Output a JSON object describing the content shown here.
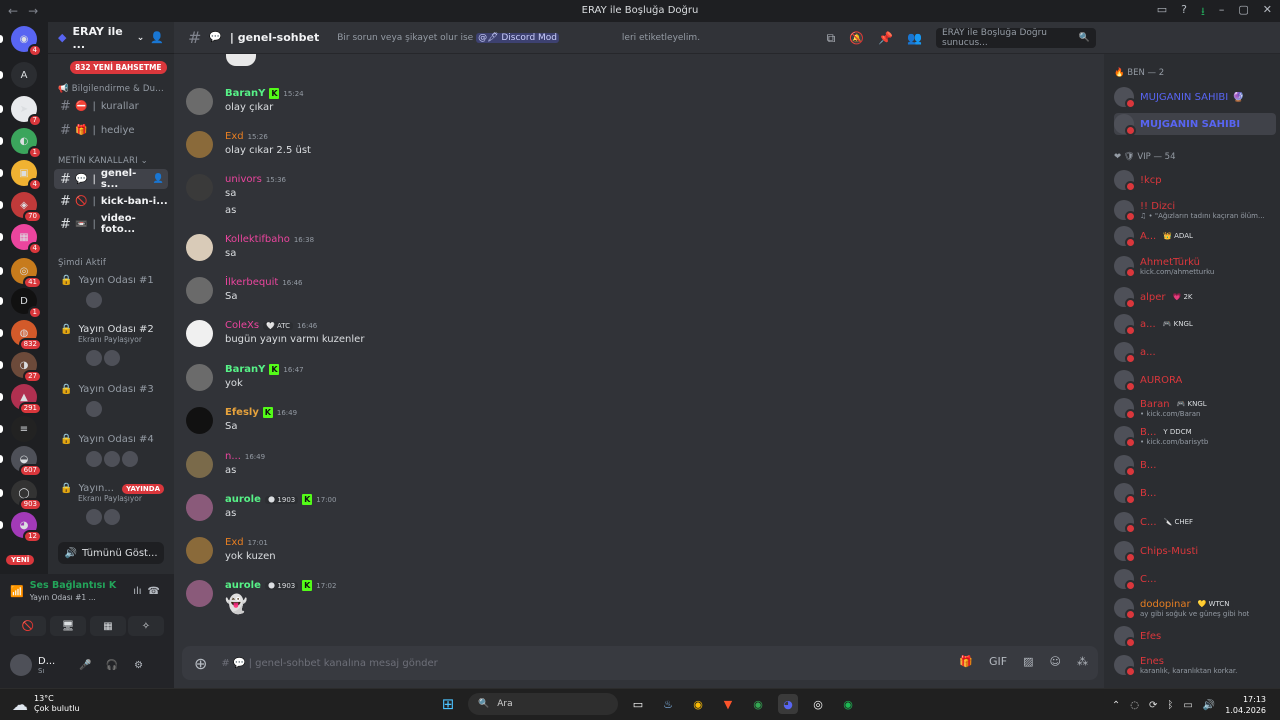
{
  "window": {
    "title": "ERAY ile Boşluğa Doğru"
  },
  "rail": {
    "servers": [
      {
        "glyph": "◉",
        "badge": "4"
      },
      {
        "glyph": "A",
        "badge": ""
      },
      {
        "glyph": "➤",
        "badge": "7"
      },
      {
        "glyph": "◐",
        "badge": "1"
      },
      {
        "glyph": "▣",
        "badge": "4"
      },
      {
        "glyph": "◈",
        "badge": "70"
      },
      {
        "glyph": "▦",
        "badge": "4"
      },
      {
        "glyph": "◎",
        "badge": "41"
      },
      {
        "glyph": "D",
        "badge": "1"
      },
      {
        "glyph": "◍",
        "badge": "832"
      },
      {
        "glyph": "◑",
        "badge": "27"
      },
      {
        "glyph": "▲",
        "badge": "291"
      },
      {
        "glyph": "≡",
        "badge": ""
      },
      {
        "glyph": "◒",
        "badge": "607"
      },
      {
        "glyph": "◯",
        "badge": "903"
      },
      {
        "glyph": "◕",
        "badge": "12"
      }
    ],
    "new_label": "YENİ"
  },
  "sidebar": {
    "guild_name": "ERAY ile ...",
    "mention_pill": "832 YENİ BAHSETME",
    "category_info": "Bilgilendirme & Du...",
    "channels_top": [
      {
        "icon": "⛔",
        "name": "kurallar"
      },
      {
        "icon": "🎁",
        "name": "hediye"
      }
    ],
    "text_category": "METİN KANALLARI",
    "text_channels": [
      {
        "icon": "💬",
        "name": "genel-s...",
        "active": true
      },
      {
        "icon": "🚫",
        "name": "kick-ban-i...",
        "active": false
      },
      {
        "icon": "📼",
        "name": "video-foto...",
        "active": false
      }
    ],
    "active_now": "Şimdi Aktif",
    "voice": [
      {
        "name": "Yayın Odası #1",
        "sub": "",
        "live": ""
      },
      {
        "name": "Yayın Odası #2",
        "sub": "Ekranı Paylaşıyor",
        "live": ""
      },
      {
        "name": "Yayın Odası #3",
        "sub": "",
        "live": ""
      },
      {
        "name": "Yayın Odası #4",
        "sub": "",
        "live": ""
      },
      {
        "name": "Yayın...",
        "sub": "Ekranı Paylaşıyor",
        "live": "YAYINDA"
      }
    ],
    "show_all": "Tümünü Göst..."
  },
  "user_panel": {
    "voice_title": "Ses Bağlantısı K",
    "voice_room": "Yayın Odası #1 ...",
    "username": "D...",
    "status": "Sı"
  },
  "chat": {
    "channel_title": "| genel-sohbet",
    "topic_prefix": "Bir sorun veya şikayet olur ise",
    "topic_mention": "@🖋 Discord Mod",
    "topic_suffix": "leri etiketleyelim.",
    "search_placeholder": "ERAY ile Boşluğa Doğru sunucus...",
    "composer_placeholder": "| genel-sohbet kanalına mesaj gönder",
    "messages": [
      {
        "author": "BaranY",
        "color": "#57f287",
        "kick": true,
        "tag": "",
        "time": "15:24",
        "lines": [
          "olay çıkar"
        ]
      },
      {
        "author": "Exd",
        "color": "#e67e22",
        "kick": false,
        "tag": "",
        "time": "15:26",
        "lines": [
          "olay cıkar 2.5 üst"
        ]
      },
      {
        "author": "univors",
        "color": "#eb459e",
        "kick": false,
        "tag": "",
        "time": "15:36",
        "lines": [
          "sa",
          "as"
        ]
      },
      {
        "author": "Kollektifbaho",
        "color": "#eb459e",
        "kick": false,
        "tag": "",
        "time": "16:38",
        "lines": [
          "sa"
        ]
      },
      {
        "author": "İlkerbequit",
        "color": "#eb459e",
        "kick": false,
        "tag": "",
        "time": "16:46",
        "lines": [
          "Sa"
        ]
      },
      {
        "author": "ColeXs",
        "color": "#eb459e",
        "kick": false,
        "tag": "🤍 ATC",
        "time": "16:46",
        "lines": [
          "bugün yayın varmı kuzenler"
        ]
      },
      {
        "author": "BaranY",
        "color": "#57f287",
        "kick": true,
        "tag": "",
        "time": "16:47",
        "lines": [
          "yok"
        ]
      },
      {
        "author": "Efesly",
        "color": "#e6a23c",
        "kick": true,
        "tag": "",
        "time": "16:49",
        "lines": [
          "Sa"
        ]
      },
      {
        "author": "n...",
        "color": "#eb459e",
        "kick": false,
        "tag": "",
        "time": "16:49",
        "lines": [
          "as"
        ]
      },
      {
        "author": "aurole",
        "color": "#57f287",
        "kick": true,
        "tag": "🌑 1903",
        "time": "17:00",
        "lines": [
          "as"
        ]
      },
      {
        "author": "Exd",
        "color": "#e67e22",
        "kick": false,
        "tag": "",
        "time": "17:01",
        "lines": [
          "yok kuzen"
        ]
      },
      {
        "author": "aurole",
        "color": "#57f287",
        "kick": true,
        "tag": "🌑 1903",
        "time": "17:02",
        "lines": [
          "👻"
        ]
      }
    ]
  },
  "members": {
    "group1": "BEN — 2",
    "group1_members": [
      {
        "name": "MÜJGANIN SAHİBİ",
        "extra": "🔮",
        "color": "#5865f2",
        "status": ""
      },
      {
        "name": "MUJGANIN SAHİBİ",
        "extra": "",
        "color": "#5865f2",
        "status": ""
      }
    ],
    "group2": "VIP — 54",
    "group2_members": [
      {
        "name": "!kcp",
        "extra": "",
        "color": "#da373c",
        "status": ""
      },
      {
        "name": "!! Dizci",
        "extra": "",
        "color": "#da373c",
        "status": "♫ • \"Ağızların tadını kaçıran ölüm..."
      },
      {
        "name": "A...",
        "extra": "👑 ADAL",
        "color": "#da373c",
        "status": ""
      },
      {
        "name": "AhmetTürkü",
        "extra": "",
        "color": "#da373c",
        "status": "kick.com/ahmetturku"
      },
      {
        "name": "alper",
        "extra": "💗 2K",
        "color": "#da373c",
        "status": ""
      },
      {
        "name": "a...",
        "extra": "🎮 KNGL",
        "color": "#da373c",
        "status": ""
      },
      {
        "name": "a...",
        "extra": "",
        "color": "#da373c",
        "status": ""
      },
      {
        "name": "AURORA",
        "extra": "",
        "color": "#da373c",
        "status": ""
      },
      {
        "name": "Baran",
        "extra": "🎮 KNGL",
        "color": "#da373c",
        "status": "• kick.com/Baran"
      },
      {
        "name": "B...",
        "extra": "Y DDCM",
        "color": "#da373c",
        "status": "• kick.com/barisytb"
      },
      {
        "name": "B...",
        "extra": "",
        "color": "#da373c",
        "status": ""
      },
      {
        "name": "B...",
        "extra": "",
        "color": "#da373c",
        "status": ""
      },
      {
        "name": "C...",
        "extra": "🔪 CHEF",
        "color": "#da373c",
        "status": ""
      },
      {
        "name": "Chips-Musti",
        "extra": "",
        "color": "#da373c",
        "status": ""
      },
      {
        "name": "C...",
        "extra": "",
        "color": "#da373c",
        "status": ""
      },
      {
        "name": "dodopinar",
        "extra": "💛 WTCN",
        "color": "#e67e22",
        "status": "ay gibi soğuk ve güneş gibi hot"
      },
      {
        "name": "Efes",
        "extra": "",
        "color": "#da373c",
        "status": ""
      },
      {
        "name": "Enes",
        "extra": "",
        "color": "#da373c",
        "status": "karanlık, karanlıktan korkar."
      }
    ]
  },
  "taskbar": {
    "temp": "13°C",
    "weather": "Çok bulutlu",
    "search": "Ara",
    "time": "17:13",
    "date": "1.04.2026"
  }
}
